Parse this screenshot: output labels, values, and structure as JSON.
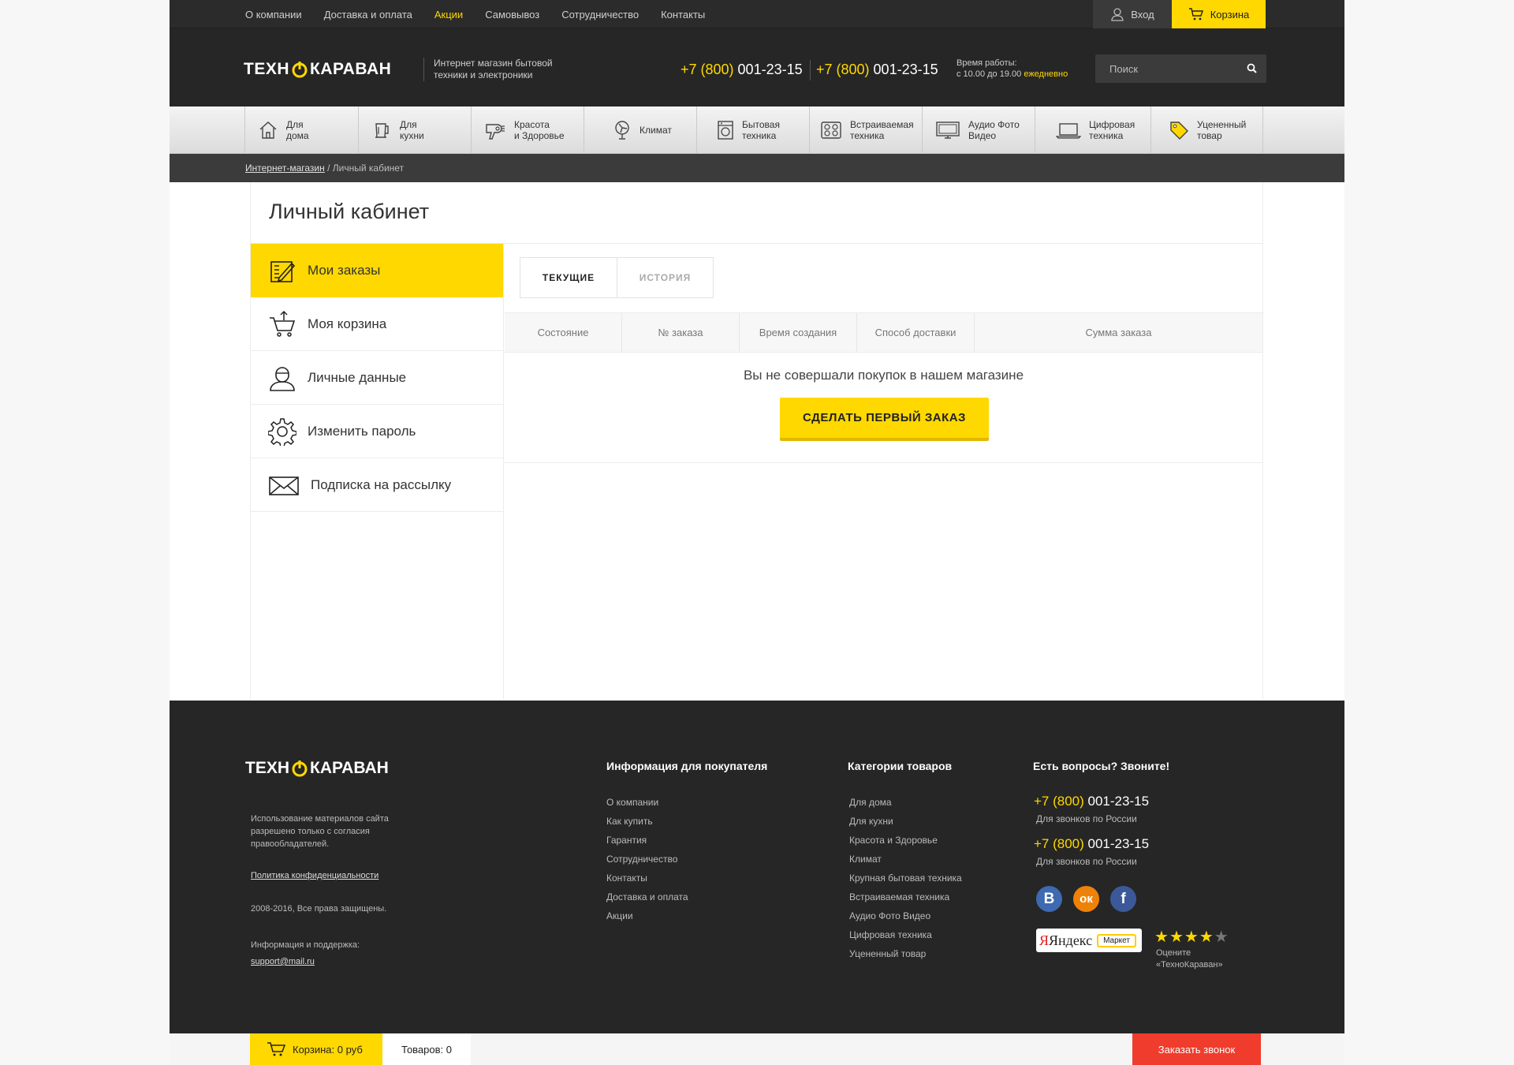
{
  "topnav": {
    "links": [
      "О компании",
      "Доставка и оплата",
      "Акции",
      "Самовывоз",
      "Сотрудничество",
      "Контакты"
    ],
    "active_link": "Акции",
    "login_label": "Вход",
    "cart_label": "Корзина"
  },
  "header": {
    "logo_left": "ТЕХН",
    "logo_right": "КАРАВАН",
    "tagline": "Интернет магазин бытовой техники и электроники",
    "phone1_code": "+7 (800)",
    "phone1_number": " 001-23-15",
    "phone2_code": "+7 (800)",
    "phone2_number": " 001-23-15",
    "hours_label": "Время работы:",
    "hours_value": "с 10.00 до 19.00",
    "hours_daily": "ежедневно",
    "search_placeholder": "Поиск"
  },
  "categories": [
    {
      "line1": "Для",
      "line2": "дома",
      "icon": "house-icon"
    },
    {
      "line1": "Для",
      "line2": "кухни",
      "icon": "kettle-icon"
    },
    {
      "line1": "Красота",
      "line2": "и Здоровье",
      "icon": "hairdryer-icon"
    },
    {
      "line1": "Климат",
      "line2": "",
      "icon": "fan-icon"
    },
    {
      "line1": "Бытовая",
      "line2": "техника",
      "icon": "washing-machine-icon"
    },
    {
      "line1": "Встраиваемая",
      "line2": "техника",
      "icon": "cooktop-icon"
    },
    {
      "line1": "Аудио Фото",
      "line2": "Видео",
      "icon": "monitor-icon"
    },
    {
      "line1": "Цифровая",
      "line2": "техника",
      "icon": "laptop-icon"
    },
    {
      "line1": "Уцененный",
      "line2": "товар",
      "icon": "price-tag-icon"
    }
  ],
  "breadcrumb": {
    "home": "Интернет-магазин",
    "separator": " / ",
    "current": "Личный кабинет"
  },
  "page_title": "Личный кабинет",
  "sidebar": {
    "items": [
      {
        "label": "Мои заказы",
        "icon": "orders-icon",
        "active": true
      },
      {
        "label": "Моя корзина",
        "icon": "cart-icon",
        "active": false
      },
      {
        "label": "Личные данные",
        "icon": "user-icon",
        "active": false
      },
      {
        "label": "Изменить пароль",
        "icon": "gear-icon",
        "active": false
      },
      {
        "label": "Подписка на рассылку",
        "icon": "envelope-icon",
        "active": false
      }
    ]
  },
  "orders": {
    "tabs": [
      "ТЕКУЩИЕ",
      "ИСТОРИЯ"
    ],
    "active_tab": "ТЕКУЩИЕ",
    "columns": [
      "Состояние",
      "№ заказа",
      "Время создания",
      "Способ доставки",
      "Сумма заказа"
    ],
    "empty_text": "Вы не совершали покупок в нашем магазине",
    "first_order_button": "СДЕЛАТЬ ПЕРВЫЙ ЗАКАЗ"
  },
  "footer": {
    "copy_text": "Использование материалов сайта разрешено только с согласия правообладателей.",
    "policy_link": "Политика конфиденциальности",
    "rights": "2008-2016, Все права защищены.",
    "support_label": "Информация и поддержка:",
    "support_email": "support@mail.ru",
    "info_title": "Информация для покупателя",
    "info_links": [
      "О компании",
      "Как купить",
      "Гарантия",
      "Сотрудничество",
      "Контакты",
      "Доставка и оплата",
      "Акции"
    ],
    "cats_title": "Категории товаров",
    "cats_links": [
      "Для дома",
      "Для кухни",
      "Красота и Здоровье",
      "Климат",
      "Крупная бытовая техника",
      "Встраиваемая техника",
      "Аудио Фото Видео",
      "Цифровая техника",
      "Уцененный товар"
    ],
    "contacts_title": "Есть вопросы? Звоните!",
    "phones": [
      {
        "code": "+7 (800)",
        "number": " 001-23-15",
        "note": "Для звонков по России"
      },
      {
        "code": "+7 (800)",
        "number": " 001-23-15",
        "note": "Для звонков по России"
      }
    ],
    "social": [
      {
        "letter": "B",
        "color": "#3d6ab0",
        "icon": "vk-icon"
      },
      {
        "letter": "ок",
        "color": "#ee8208",
        "icon": "odnoklassniki-icon"
      },
      {
        "letter": "f",
        "color": "#3b5998",
        "icon": "facebook-icon"
      }
    ],
    "yandex_word": "Яндекс",
    "market_word": "Маркет",
    "rating_stars": 4,
    "rating_max": 5,
    "rate_text_1": "Оцените",
    "rate_text_2": "«ТехноКараван»"
  },
  "bottombar": {
    "cart_text": "Корзина: 0 руб",
    "items_text": "Товаров: 0",
    "callback_label": "Заказать звонок"
  },
  "colors": {
    "accent": "#ffd800",
    "dark": "#262626",
    "callback": "#f03c2d"
  }
}
